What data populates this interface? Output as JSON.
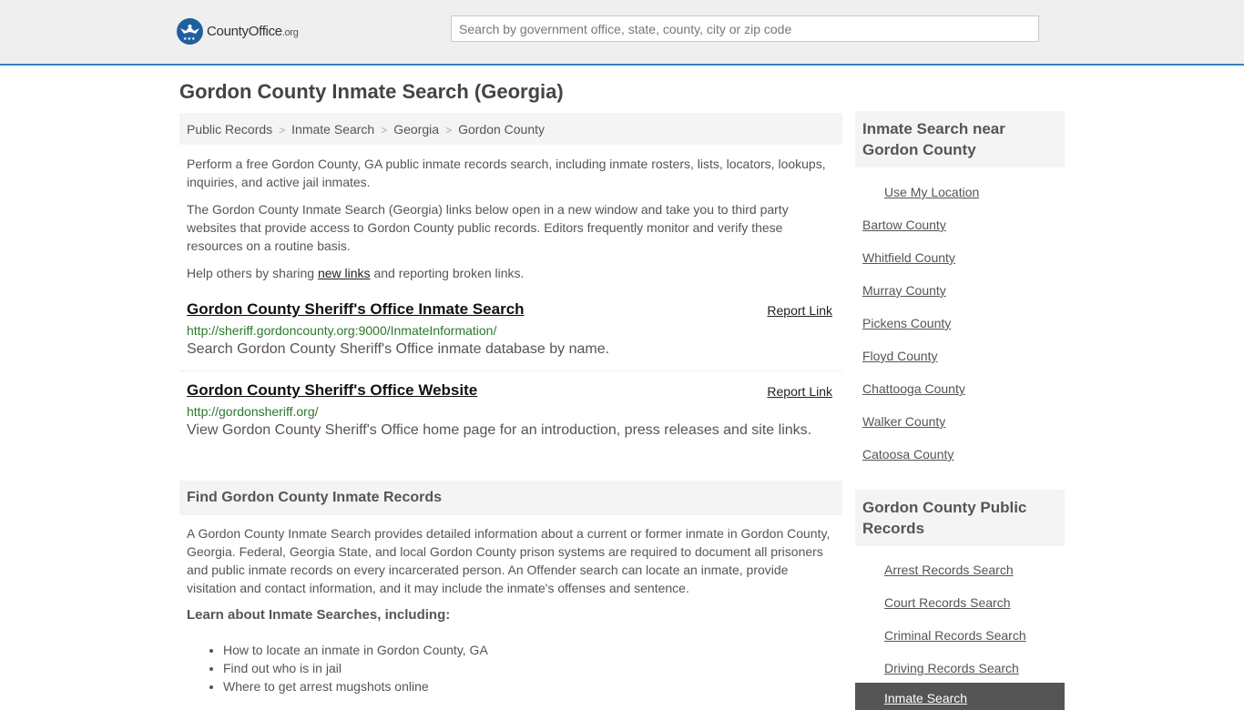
{
  "header": {
    "logo_main": "CountyOffice",
    "logo_suffix": ".org",
    "search_placeholder": "Search by government office, state, county, city or zip code"
  },
  "page_title": "Gordon County Inmate Search (Georgia)",
  "breadcrumb": [
    "Public Records",
    "Inmate Search",
    "Georgia",
    "Gordon County"
  ],
  "breadcrumb_sep": ">",
  "intro": {
    "p1": "Perform a free Gordon County, GA public inmate records search, including inmate rosters, lists, locators, lookups, inquiries, and active jail inmates.",
    "p2": "The Gordon County Inmate Search (Georgia) links below open in a new window and take you to third party websites that provide access to Gordon County public records. Editors frequently monitor and verify these resources on a routine basis.",
    "p3_before": "Help others by sharing ",
    "p3_link": "new links",
    "p3_after": " and reporting broken links."
  },
  "links": [
    {
      "title": "Gordon County Sheriff's Office Inmate Search",
      "report": "Report Link",
      "url": "http://sheriff.gordoncounty.org:9000/InmateInformation/",
      "desc": "Search Gordon County Sheriff's Office inmate database by name."
    },
    {
      "title": "Gordon County Sheriff's Office Website",
      "report": "Report Link",
      "url": "http://gordonsheriff.org/",
      "desc": "View Gordon County Sheriff's Office home page for an introduction, press releases and site links."
    }
  ],
  "find_section": {
    "heading": "Find Gordon County Inmate Records",
    "body": "A Gordon County Inmate Search provides detailed information about a current or former inmate in Gordon County, Georgia. Federal, Georgia State, and local Gordon County prison systems are required to document all prisoners and public inmate records on every incarcerated person. An Offender search can locate an inmate, provide visitation and contact information, and it may include the inmate's offenses and sentence.",
    "learn_heading": "Learn about Inmate Searches, including:",
    "bullets": [
      "How to locate an inmate in Gordon County, GA",
      "Find out who is in jail",
      "Where to get arrest mugshots online"
    ]
  },
  "sidebar": {
    "nearby_heading": "Inmate Search near Gordon County",
    "use_location": "Use My Location",
    "nearby": [
      "Bartow County",
      "Whitfield County",
      "Murray County",
      "Pickens County",
      "Floyd County",
      "Chattooga County",
      "Walker County",
      "Catoosa County"
    ],
    "records_heading": "Gordon County Public Records",
    "records": [
      "Arrest Records Search",
      "Court Records Search",
      "Criminal Records Search",
      "Driving Records Search"
    ],
    "active_item": "Inmate Search"
  },
  "colors": {
    "header_bg": "#efefef",
    "header_border": "#3a7fc4",
    "url_green": "#2a7a2a",
    "active_bg": "#555555"
  }
}
